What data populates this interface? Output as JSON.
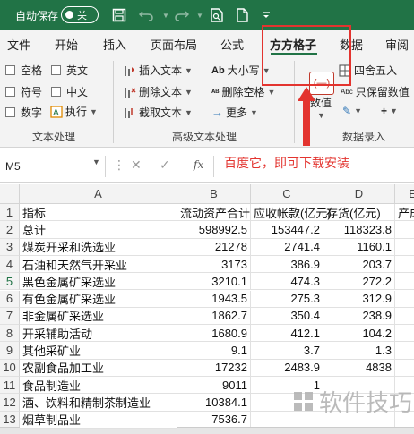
{
  "titlebar": {
    "autosave_label": "自动保存",
    "toggle_text": "关"
  },
  "tabs": [
    "文件",
    "开始",
    "插入",
    "页面布局",
    "公式",
    "方方格子",
    "数据",
    "审阅"
  ],
  "active_tab": "方方格子",
  "ribbon": {
    "text_group": {
      "label": "文本处理",
      "checkboxes": [
        "空格",
        "英文",
        "符号",
        "中文",
        "数字"
      ],
      "exec_label": "执行"
    },
    "adv_group": {
      "label": "高级文本处理",
      "col1": [
        "插入文本",
        "删除文本",
        "截取文本"
      ],
      "col2": [
        "大小写",
        "删除空格",
        "更多"
      ]
    },
    "num_group": {
      "label": "数据录入",
      "num_button": "数值",
      "num_icon_text": "(—)",
      "items": [
        "四舍五入",
        "只保留数值"
      ]
    }
  },
  "formula_bar": {
    "cell_ref": "M5",
    "fx": "fx",
    "annotation": "百度它，即可下载安装"
  },
  "grid": {
    "columns": [
      "A",
      "B",
      "C",
      "D",
      "E"
    ],
    "selected_row": "5",
    "rows": [
      {
        "n": "1",
        "a": "指标",
        "b": "流动资产合计",
        "c": "应收帐款(亿元)",
        "d": "存货(亿元)",
        "e": "产成"
      },
      {
        "n": "2",
        "a": "总计",
        "b": "598992.5",
        "c": "153447.2",
        "d": "118323.8",
        "e": ""
      },
      {
        "n": "3",
        "a": "煤炭开采和洗选业",
        "b": "21278",
        "c": "2741.4",
        "d": "1160.1",
        "e": ""
      },
      {
        "n": "4",
        "a": "石油和天然气开采业",
        "b": "3173",
        "c": "386.9",
        "d": "203.7",
        "e": ""
      },
      {
        "n": "5",
        "a": "黑色金属矿采选业",
        "b": "3210.1",
        "c": "474.3",
        "d": "272.2",
        "e": ""
      },
      {
        "n": "6",
        "a": "有色金属矿采选业",
        "b": "1943.5",
        "c": "275.3",
        "d": "312.9",
        "e": ""
      },
      {
        "n": "7",
        "a": "非金属矿采选业",
        "b": "1862.7",
        "c": "350.4",
        "d": "238.9",
        "e": ""
      },
      {
        "n": "8",
        "a": "开采辅助活动",
        "b": "1680.9",
        "c": "412.1",
        "d": "104.2",
        "e": ""
      },
      {
        "n": "9",
        "a": "其他采矿业",
        "b": "9.1",
        "c": "3.7",
        "d": "1.3",
        "e": ""
      },
      {
        "n": "10",
        "a": "农副食品加工业",
        "b": "17232",
        "c": "2483.9",
        "d": "4838",
        "e": ""
      },
      {
        "n": "11",
        "a": "食品制造业",
        "b": "9011",
        "c": "1",
        "d": "",
        "e": ""
      },
      {
        "n": "12",
        "a": "酒、饮料和精制茶制造业",
        "b": "10384.1",
        "c": "",
        "d": "",
        "e": ""
      },
      {
        "n": "13",
        "a": "烟草制品业",
        "b": "7536.7",
        "c": "",
        "d": "",
        "e": ""
      }
    ]
  },
  "watermark": "软件技巧",
  "colors": {
    "accent": "#217346",
    "highlight": "#e3342f"
  }
}
